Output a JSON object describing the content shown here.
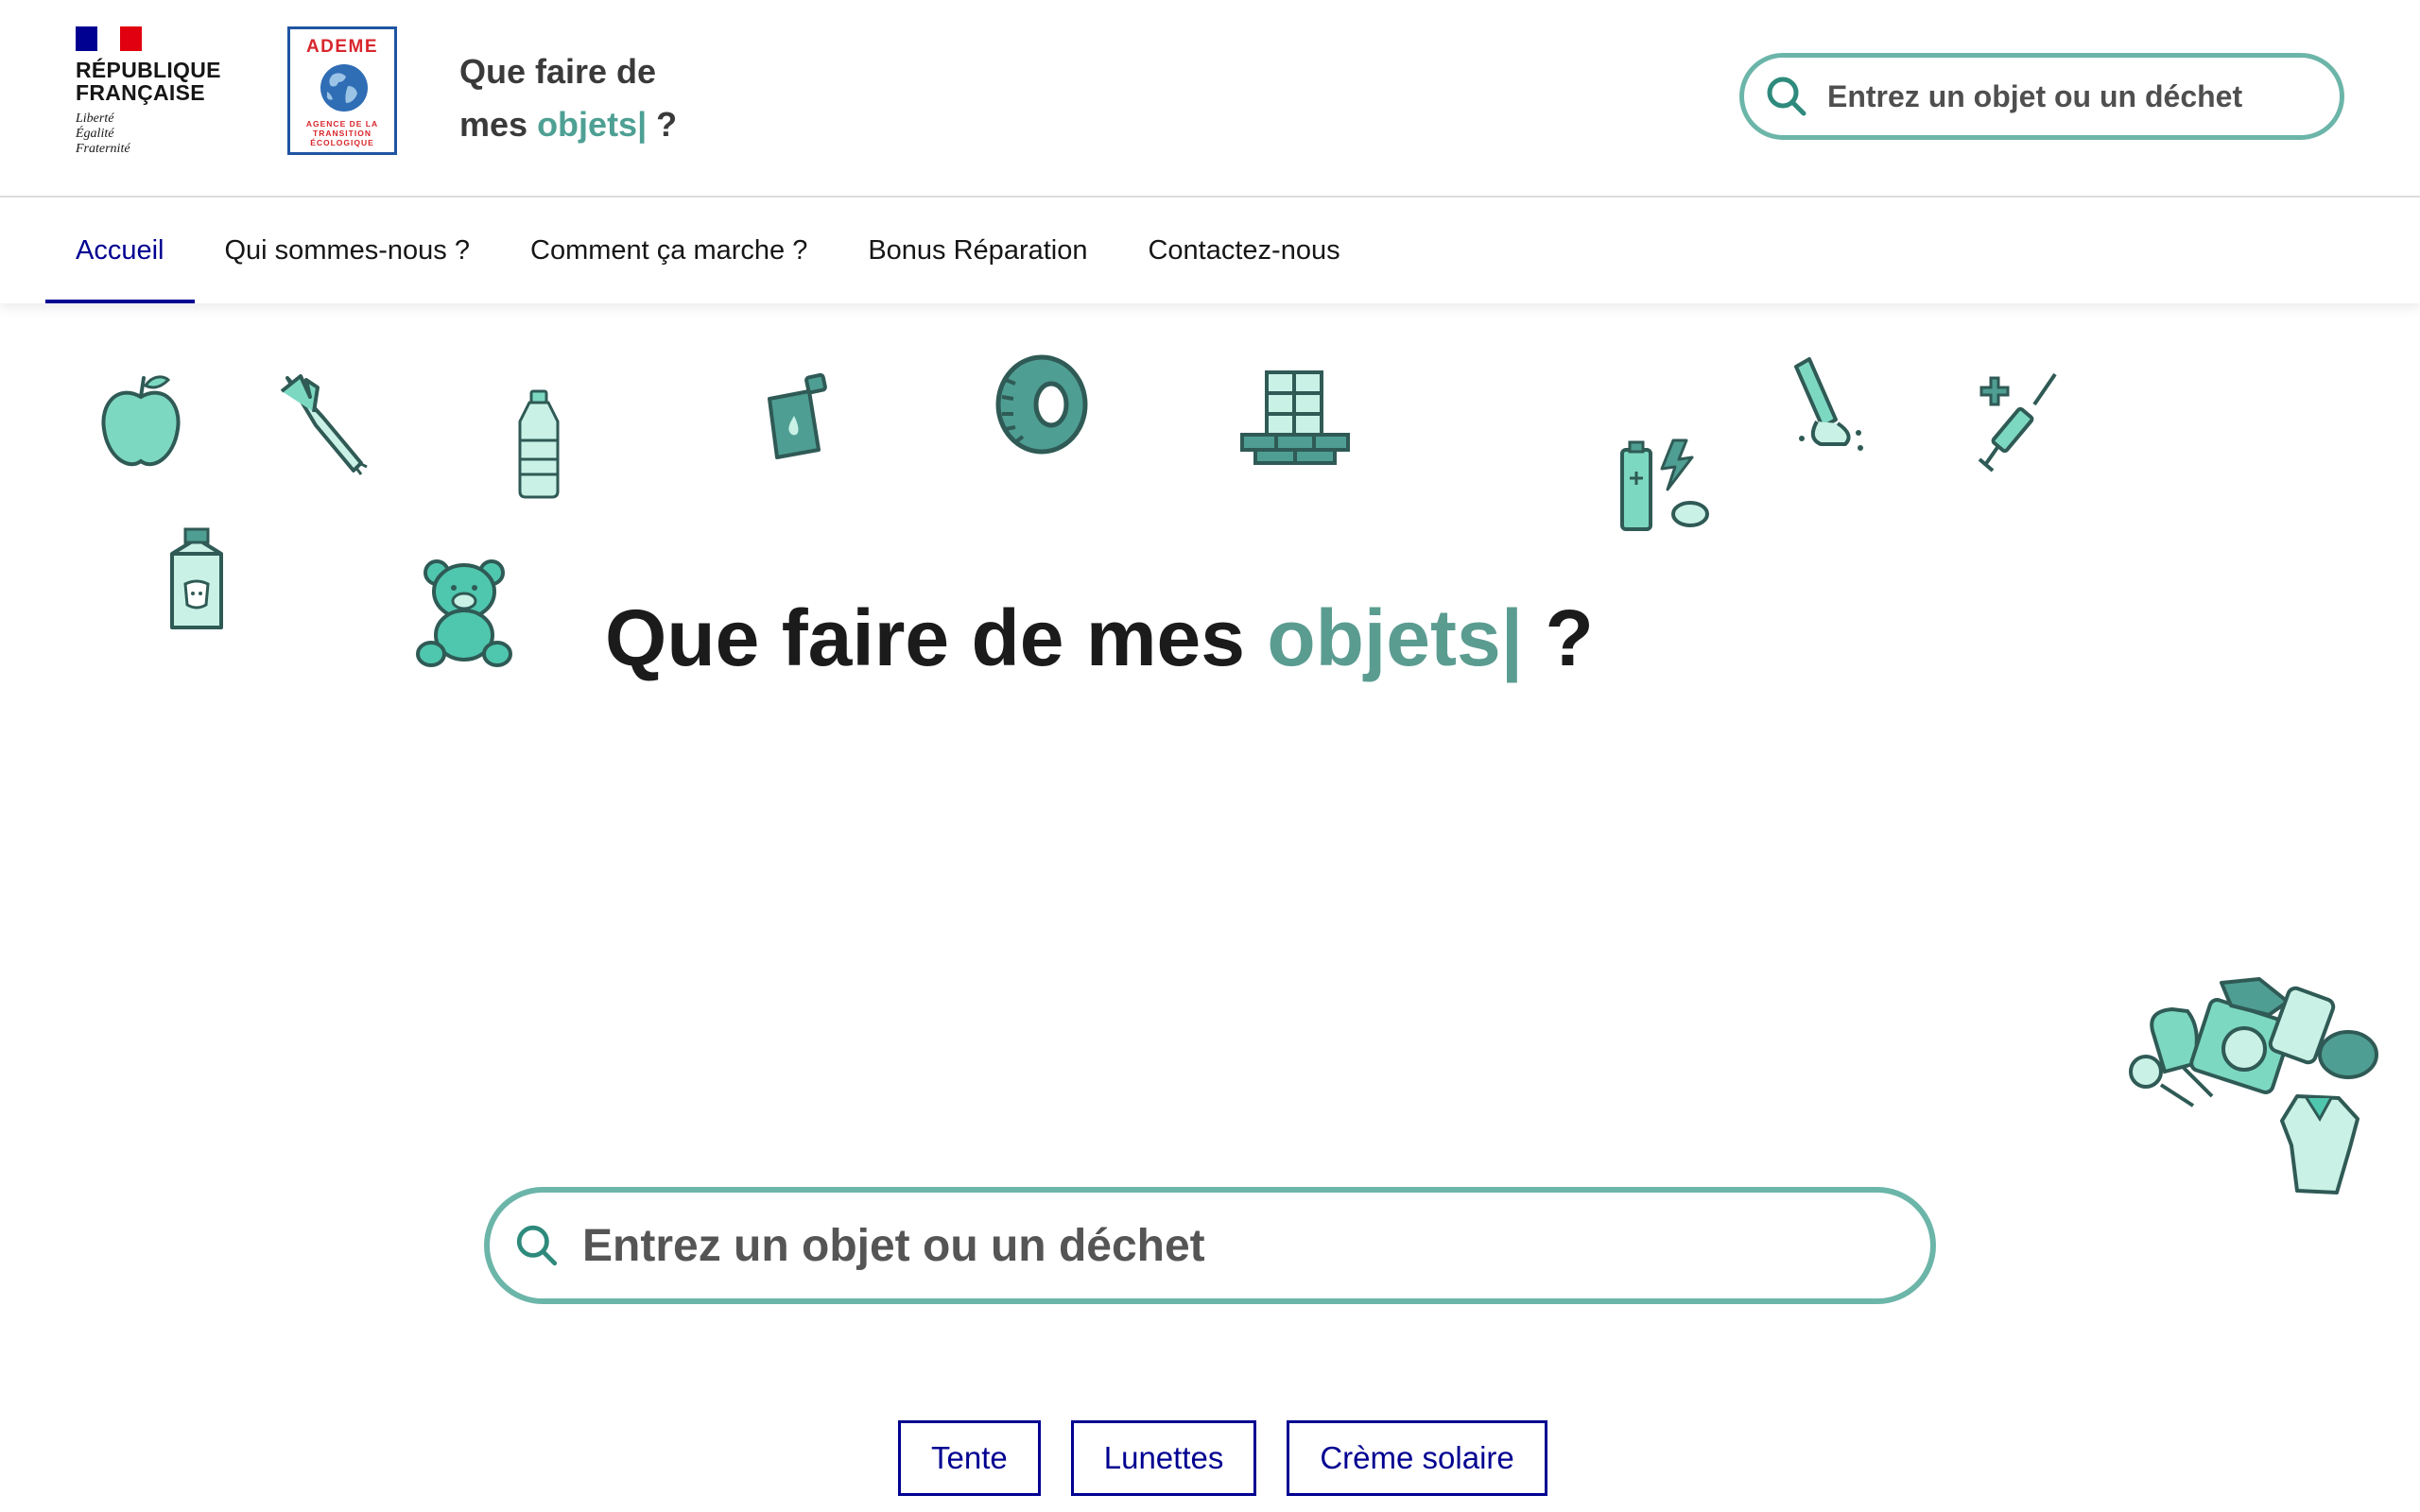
{
  "header": {
    "republic": {
      "name_line1": "RÉPUBLIQUE",
      "name_line2": "FRANÇAISE",
      "motto_line1": "Liberté",
      "motto_line2": "Égalité",
      "motto_line3": "Fraternité"
    },
    "ademe": {
      "title": "ADEME",
      "sub_line1": "AGENCE DE LA",
      "sub_line2": "TRANSITION",
      "sub_line3": "ÉCOLOGIQUE"
    },
    "site_title": {
      "line1": "Que faire de",
      "line2_prefix": "mes ",
      "line2_accent": "objets|",
      "line2_suffix": " ?"
    },
    "search": {
      "placeholder": "Entrez un objet ou un déchet",
      "icon": "search-icon"
    }
  },
  "nav": {
    "items": [
      {
        "label": "Accueil",
        "active": true
      },
      {
        "label": "Qui sommes-nous ?",
        "active": false
      },
      {
        "label": "Comment ça marche ?",
        "active": false
      },
      {
        "label": "Bonus Réparation",
        "active": false
      },
      {
        "label": "Contactez-nous",
        "active": false
      }
    ]
  },
  "hero": {
    "title_prefix": "Que faire de mes ",
    "title_accent": "objets|",
    "title_suffix": " ?",
    "search_placeholder": "Entrez un objet ou un déchet",
    "suggestions": [
      "Tente",
      "Lunettes",
      "Crème solaire"
    ],
    "illustrations": [
      "apple-icon",
      "leek-icon",
      "water-bottle-icon",
      "oil-can-icon",
      "tire-icon",
      "window-icon",
      "battery-icon",
      "cigarette-icon",
      "syringe-icon",
      "milk-carton-icon",
      "teddy-bear-icon",
      "household-objects-pile"
    ]
  },
  "colors": {
    "accent_green": "#5b9c91",
    "search_border": "#6cb5a9",
    "nav_blue": "#000091",
    "illustration_fill": "#7dd8c2",
    "illustration_stroke": "#2f5a55"
  }
}
